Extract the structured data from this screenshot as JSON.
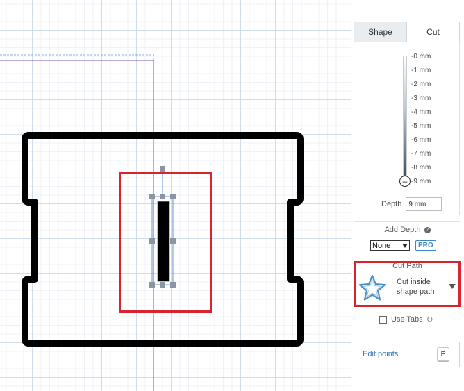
{
  "tabs": {
    "shape": "Shape",
    "cut": "Cut"
  },
  "depth_scale": [
    "-0 mm",
    "-1 mm",
    "-2 mm",
    "-3 mm",
    "-4 mm",
    "-5 mm",
    "-6 mm",
    "-7 mm",
    "-8 mm",
    "-9 mm"
  ],
  "depth": {
    "label": "Depth",
    "value": "9 mm"
  },
  "add_depth": {
    "label": "Add Depth",
    "selected": "None",
    "pro": "PRO"
  },
  "cut_path": {
    "title": "Cut Path",
    "line1": "Cut inside",
    "line2": "shape path"
  },
  "use_tabs": {
    "label": "Use Tabs",
    "checked": false
  },
  "edit_points": {
    "label": "Edit points",
    "shortcut": "E"
  },
  "colors": {
    "highlight": "#d8242f",
    "accent": "#2f76b8",
    "selection_guide": "#6a5acd"
  }
}
